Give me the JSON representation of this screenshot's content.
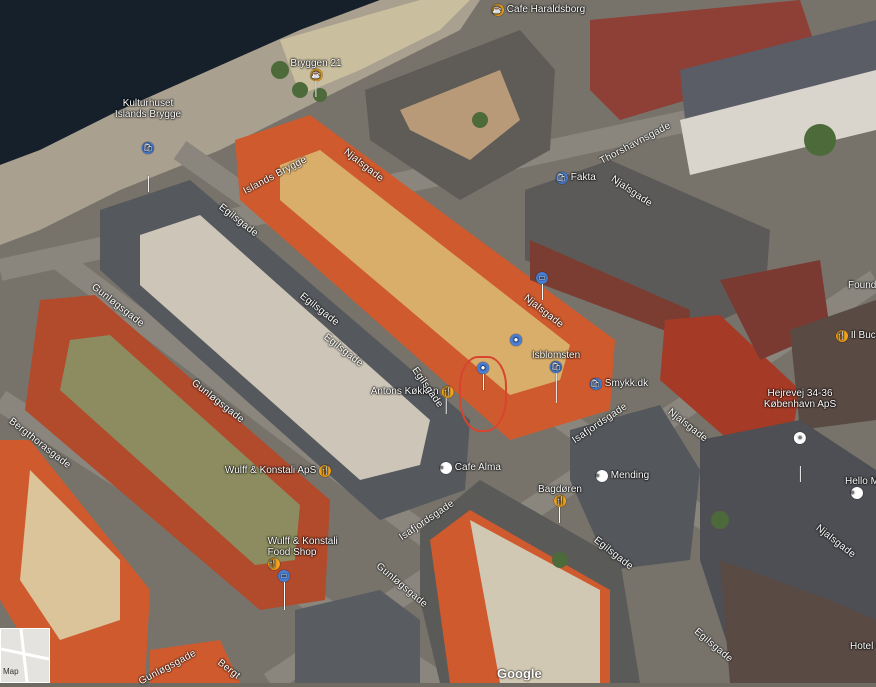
{
  "map": {
    "minimap_label": "Map",
    "logo": "Google",
    "pois": [
      {
        "name": "Cafe Haraldsborg",
        "icon": "cafe-icon",
        "type": "orange"
      },
      {
        "name": "Bryggen 21",
        "icon": "cafe-icon",
        "type": "orange"
      },
      {
        "name": "Kulturhuset\nIslands Brygge",
        "icon": "shopping-icon",
        "type": "blue"
      },
      {
        "name": "Fakta",
        "icon": "shopping-icon",
        "type": "blue"
      },
      {
        "name": "",
        "icon": "transit-icon",
        "type": "blue"
      },
      {
        "name": "",
        "icon": "place-icon",
        "type": "blue"
      },
      {
        "name": "",
        "icon": "location-dot-icon",
        "type": "blue"
      },
      {
        "name": "Isblomsten",
        "icon": "shopping-icon",
        "type": "blue"
      },
      {
        "name": "Smykk.dk",
        "icon": "shopping-icon",
        "type": "blue"
      },
      {
        "name": "Antons Køkken",
        "icon": "restaurant-icon",
        "type": "orange"
      },
      {
        "name": "Cafe Alma",
        "icon": "place-icon",
        "type": "white"
      },
      {
        "name": "Wulff & Konstali ApS",
        "icon": "restaurant-icon",
        "type": "orange"
      },
      {
        "name": "Wulff & Konstali\nFood Shop",
        "icon": "restaurant-icon",
        "type": "orange"
      },
      {
        "name": "Bagdøren",
        "icon": "restaurant-icon",
        "type": "orange"
      },
      {
        "name": "Mending",
        "icon": "place-icon",
        "type": "white"
      },
      {
        "name": "Hejrevej 34-36\nKøbenhavn ApS",
        "icon": "place-icon",
        "type": "white"
      },
      {
        "name": "Il Buco",
        "icon": "restaurant-icon",
        "type": "orange"
      },
      {
        "name": "Founde",
        "icon": "place-icon",
        "type": "white"
      },
      {
        "name": "Hello M",
        "icon": "place-icon",
        "type": "white"
      },
      {
        "name": "Hotel C",
        "icon": "place-icon",
        "type": "white"
      },
      {
        "name": "",
        "icon": "transit-icon",
        "type": "blue"
      }
    ],
    "streets": [
      "Islands Brygge",
      "Njalsgade",
      "Egilsgade",
      "Thorshavnsgade",
      "Njalsgade",
      "Egilsgade",
      "Gunløgsgade",
      "Egilsgade",
      "Gunløgsgade",
      "Bergthorasgade",
      "Isafjordsgade",
      "Isafjordsgade",
      "Egilsgade",
      "Egilsgade",
      "Njalsgade",
      "Njalsgade",
      "Gunløgsgade",
      "Egilsgade",
      "Njalsgade",
      "Gunløgsgade",
      "Bergt"
    ]
  }
}
